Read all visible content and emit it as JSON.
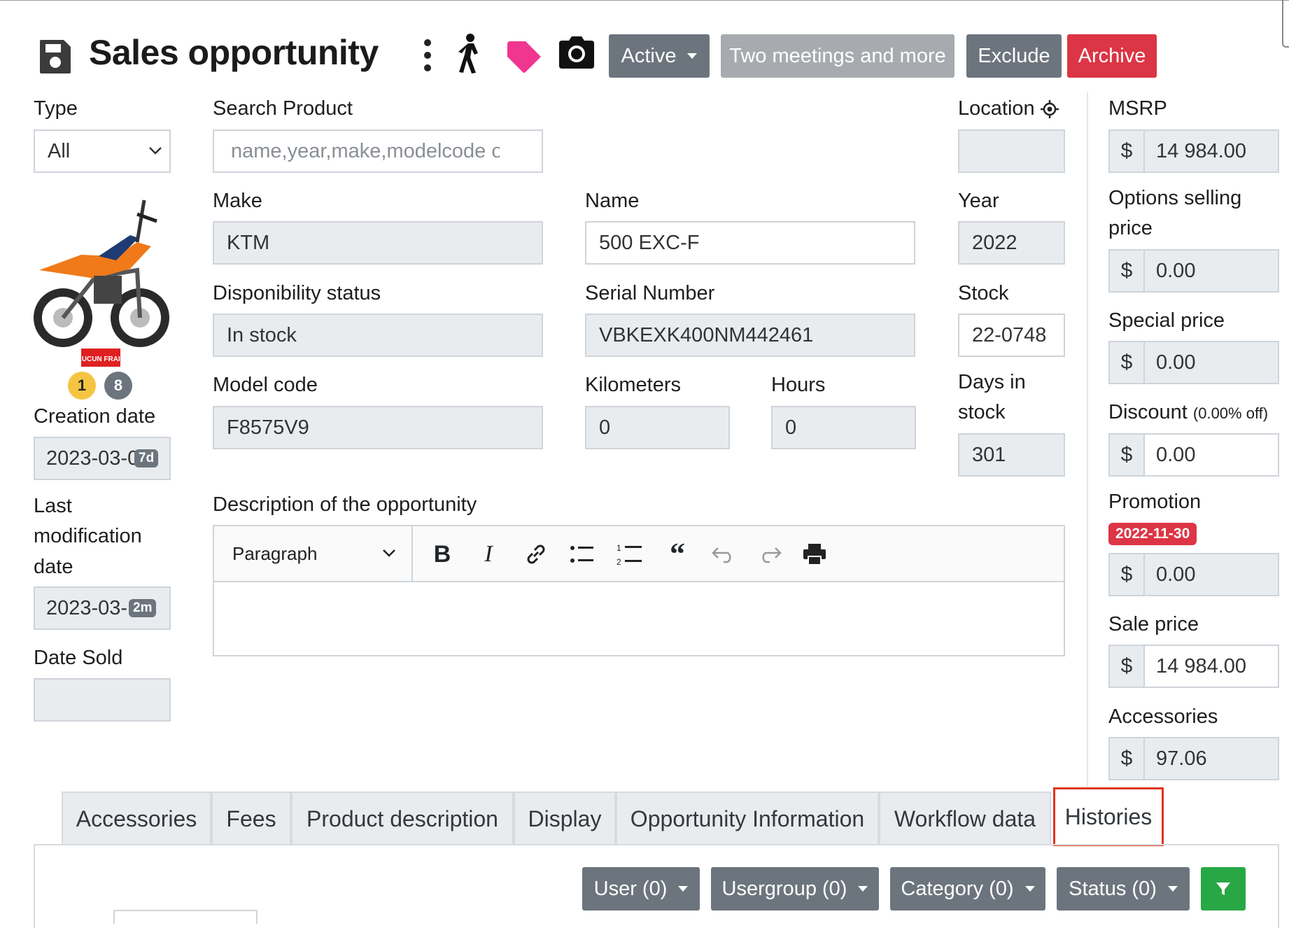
{
  "header": {
    "title": "Sales opportunity",
    "icons": [
      "save-icon",
      "kebab-menu-icon",
      "walking-person-icon",
      "tag-icon",
      "camera-icon"
    ],
    "buttons": {
      "active": "Active",
      "two_meetings": "Two meetings and more",
      "exclude": "Exclude",
      "archive": "Archive"
    }
  },
  "left": {
    "type_label": "Type",
    "type_value": "All",
    "product_image_text": "AUCUN FRAIS",
    "badge_yellow": "1",
    "badge_gray": "8",
    "creation_label": "Creation date",
    "creation_value": "2023-03-0",
    "creation_badge": "7d",
    "lastmod_label_1": "Last",
    "lastmod_label_2": "modification",
    "lastmod_label_3": "date",
    "lastmod_value": "2023-03-1",
    "lastmod_badge": "2m",
    "datesold_label": "Date Sold"
  },
  "center": {
    "search_label": "Search Product",
    "search_placeholder": "name,year,make,modelcode or",
    "make_label": "Make",
    "make_value": "KTM",
    "name_label": "Name",
    "name_value": "500 EXC-F",
    "dispo_label": "Disponibility status",
    "dispo_value": "In stock",
    "serial_label": "Serial Number",
    "serial_value": "VBKEXK400NM442461",
    "model_label": "Model code",
    "model_value": "F8575V9",
    "km_label": "Kilometers",
    "km_value": "0",
    "hours_label": "Hours",
    "hours_value": "0",
    "desc_label": "Description of the opportunity",
    "editor_paragraph": "Paragraph"
  },
  "right": {
    "location_label": "Location",
    "year_label": "Year",
    "year_value": "2022",
    "stock_label": "Stock",
    "stock_value": "22-0748",
    "days_label_1": "Days in",
    "days_label_2": "stock",
    "days_value": "301"
  },
  "pricing": {
    "currency": "$",
    "msrp_label": "MSRP",
    "msrp_value": "14 984.00",
    "options_label_1": "Options selling",
    "options_label_2": "price",
    "options_value": "0.00",
    "special_label": "Special price",
    "special_value": "0.00",
    "discount_label": "Discount",
    "discount_note": "(0.00% off)",
    "discount_value": "0.00",
    "promotion_label": "Promotion",
    "promotion_date": "2022-11-30",
    "promotion_value": "0.00",
    "sale_label": "Sale price",
    "sale_value": "14 984.00",
    "accessories_label": "Accessories",
    "accessories_value": "97.06"
  },
  "tabs": [
    "Accessories",
    "Fees",
    "Product description",
    "Display",
    "Opportunity Information",
    "Workflow data",
    "Histories"
  ],
  "active_tab": "Histories",
  "filters": {
    "user": "User (0)",
    "usergroup": "Usergroup (0)",
    "category": "Category (0)",
    "status": "Status (0)"
  },
  "colors": {
    "gray_button": "#6c757d",
    "light_button": "#a7abaf",
    "danger": "#dc3545",
    "success": "#28a745",
    "tag": "#f0368f",
    "highlight": "#e0351e"
  }
}
